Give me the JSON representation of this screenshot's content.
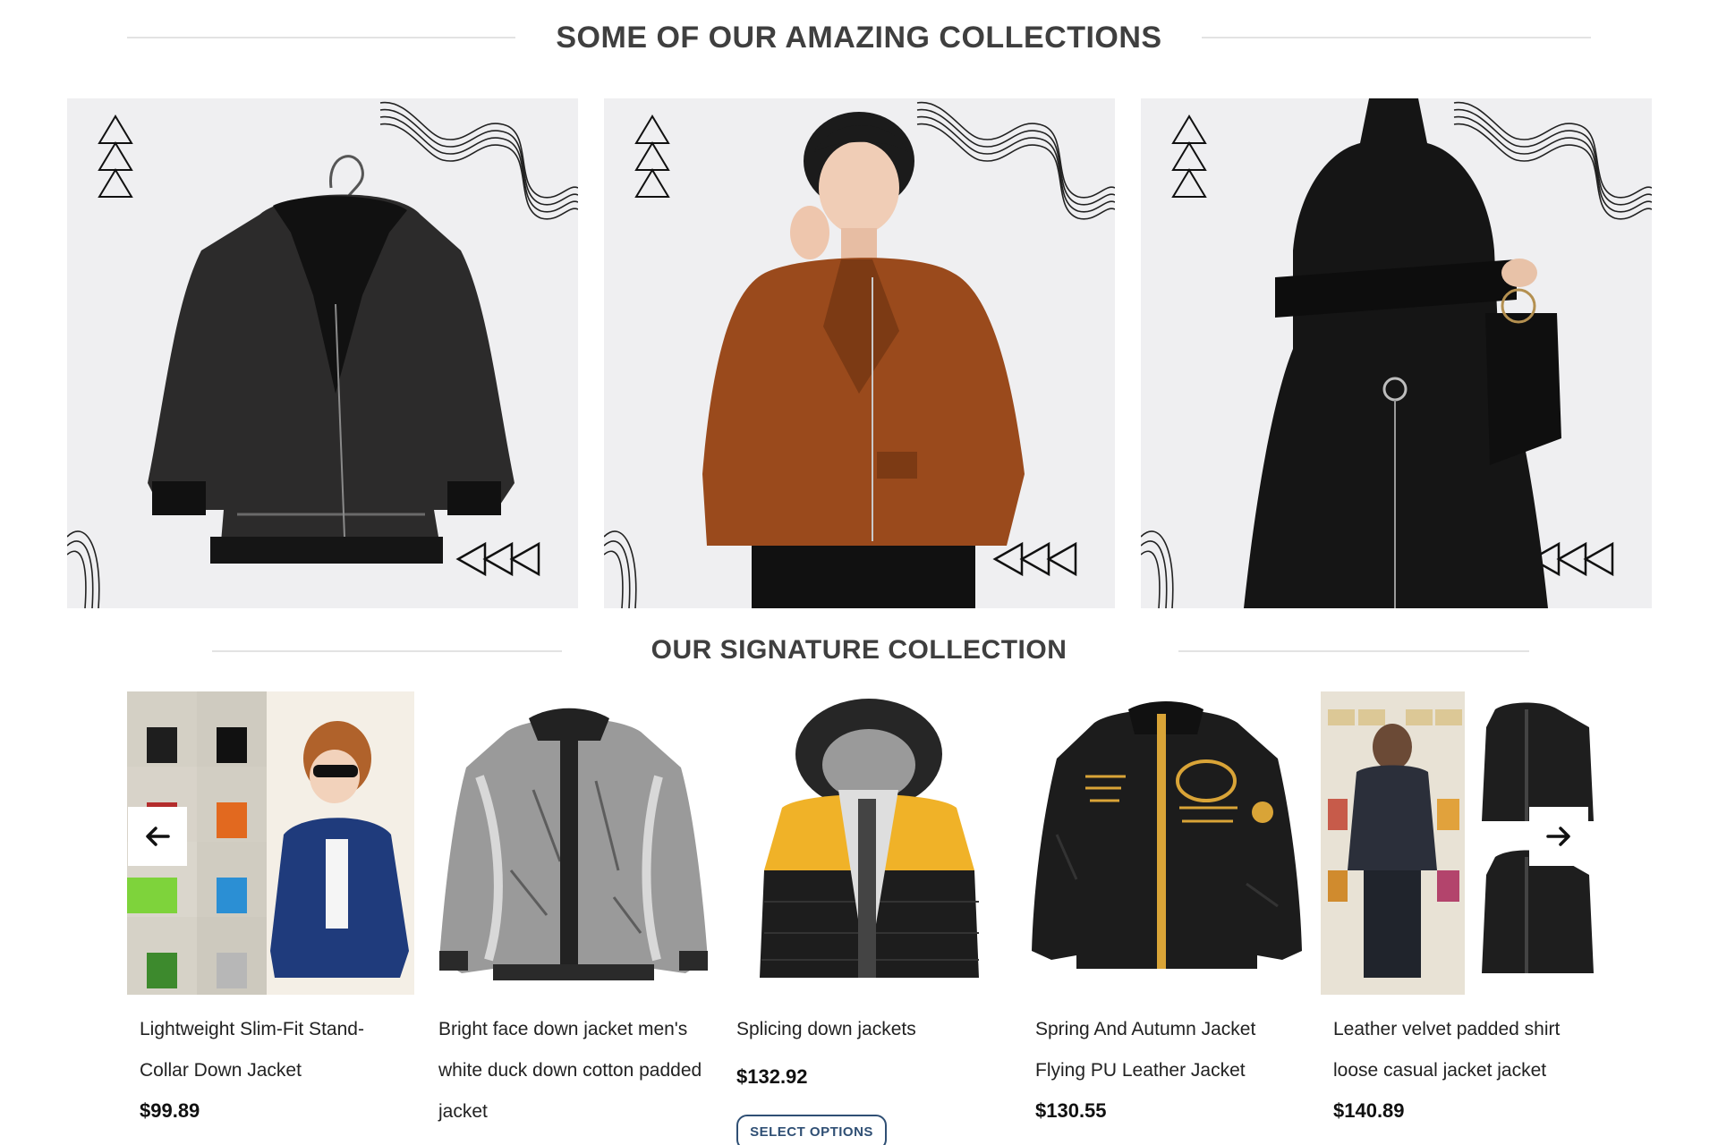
{
  "collections_heading": "SOME OF OUR AMAZING COLLECTIONS",
  "signature_heading": "OUR SIGNATURE COLLECTION",
  "collections": [
    {
      "image": "black-shearling-biker-jacket-image"
    },
    {
      "image": "man-in-brown-leather-jacket-image"
    },
    {
      "image": "woman-in-black-leather-dress-image"
    }
  ],
  "products": [
    {
      "name": "Lightweight Slim-Fit Stand-Collar Down Jacket",
      "price": "$99.89",
      "image": "navy-down-jacket-image"
    },
    {
      "name": "Bright face down jacket men's white duck down cotton padded jacket",
      "price": "",
      "image": "silver-bomber-jacket-image"
    },
    {
      "name": "Splicing down jackets",
      "price": "$132.92",
      "button": "SELECT OPTIONS",
      "image": "yellow-black-hooded-puffer-image"
    },
    {
      "name": "Spring And Autumn Jacket Flying PU Leather Jacket",
      "price": "$130.55",
      "image": "black-embroidered-leather-jacket-image"
    },
    {
      "name": "Leather velvet padded shirt loose casual jacket jacket",
      "price": "$140.89",
      "image": "black-padded-shirt-jacket-image"
    }
  ],
  "icons": {
    "prev": "arrow-left-icon",
    "next": "arrow-right-icon"
  },
  "colors": {
    "heading": "#3f3f3f",
    "card_bg": "#efeff1",
    "button_border": "#2f4f74"
  }
}
